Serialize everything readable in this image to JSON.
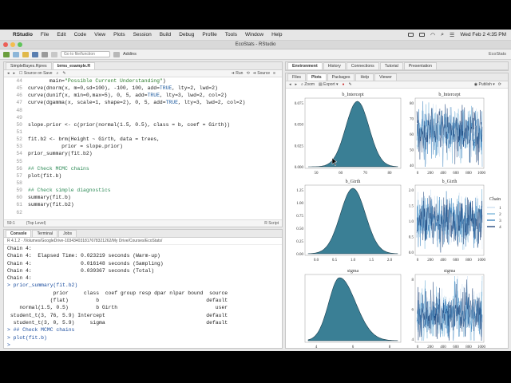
{
  "menubar": {
    "app": "RStudio",
    "items": [
      "File",
      "Edit",
      "Code",
      "View",
      "Plots",
      "Session",
      "Build",
      "Debug",
      "Profile",
      "Tools",
      "Window",
      "Help"
    ],
    "clock": "Wed Feb 2  4:35 PM"
  },
  "window": {
    "title": "EcoStats - RStudio"
  },
  "toolbar": {
    "goto_placeholder": "Go to file/function",
    "addins": "Addins",
    "project": "EcoStats"
  },
  "editor": {
    "tabs": [
      "SimpleBayes.Rpres",
      "brms_example.R"
    ],
    "source_on_save": "Source on Save",
    "run": "Run",
    "source": "Source",
    "lines": [
      {
        "n": "44",
        "t": "       main=\"Possible Current Understanding\")"
      },
      {
        "n": "45",
        "t": "curve(dnorm(x, m=0,sd=100), -100, 100, add=TRUE, lty=2, lwd=2)"
      },
      {
        "n": "46",
        "t": "curve(dunif(x, min=0,max=5), 0, 5, add=TRUE, lty=3, lwd=2, col=2)"
      },
      {
        "n": "47",
        "t": "curve(dgamma(x, scale=1, shape=2), 0, 5, add=TRUE, lty=3, lwd=2, col=2)"
      },
      {
        "n": "48",
        "t": ""
      },
      {
        "n": "49",
        "t": ""
      },
      {
        "n": "50",
        "t": "slope.prior <- c(prior(normal(1.5, 0.5), class = b, coef = Girth))"
      },
      {
        "n": "51",
        "t": ""
      },
      {
        "n": "52",
        "t": "fit.b2 <- brm(Height ~ Girth, data = trees,"
      },
      {
        "n": "53",
        "t": "           prior = slope.prior)"
      },
      {
        "n": "54",
        "t": "prior_summary(fit.b2)"
      },
      {
        "n": "55",
        "t": ""
      },
      {
        "n": "56",
        "t": "## Check MCMC chains"
      },
      {
        "n": "57",
        "t": "plot(fit.b)"
      },
      {
        "n": "58",
        "t": ""
      },
      {
        "n": "59",
        "t": "## Check simple diagnostics"
      },
      {
        "n": "60",
        "t": "summary(fit.b)"
      },
      {
        "n": "61",
        "t": "summary(fit.b2)"
      },
      {
        "n": "62",
        "t": ""
      }
    ],
    "status_pos": "59:1",
    "status_level": "(Top Level)",
    "status_type": "R Script"
  },
  "console": {
    "tabs": [
      "Console",
      "Terminal",
      "Jobs"
    ],
    "path": "R 4.1.2 · /Volumes/GoogleDrive-103434031817678321262/My Drive/Courses/EcoStats/",
    "lines": [
      "Chain 4:",
      "Chain 4:  Elapsed Time: 0.023219 seconds (Warm-up)",
      "Chain 4:                0.016148 seconds (Sampling)",
      "Chain 4:                0.039367 seconds (Total)",
      "Chain 4:",
      "> prior_summary(fit.b2)",
      "               prior     class  coef group resp dpar nlpar bound  source",
      "              (flat)         b                                   default",
      "    normal(1.5, 0.5)         b Girth                                user",
      " student_t(3, 76, 5.9) Intercept                                 default",
      "  student_t(3, 0, 5.9)     sigma                                 default",
      "> ## Check MCMC chains",
      "> plot(fit.b)",
      ">"
    ]
  },
  "env": {
    "tabs": [
      "Environment",
      "History",
      "Connections",
      "Tutorial",
      "Presentation"
    ]
  },
  "plots": {
    "tabs": [
      "Files",
      "Plots",
      "Packages",
      "Help",
      "Viewer"
    ],
    "zoom": "Zoom",
    "export": "Export",
    "publish": "Publish",
    "titles": [
      "b_Intercept",
      "b_Intercept",
      "b_Girth",
      "b_Girth",
      "sigma",
      "sigma"
    ],
    "legend_title": "Chain",
    "legend_items": [
      "1",
      "2",
      "3",
      "4"
    ],
    "dens_axes": [
      {
        "y": [
          "0.075",
          "0.050",
          "0.025",
          "0.000"
        ],
        "x": [
          "50",
          "60",
          "70",
          "80"
        ]
      },
      {
        "y": [
          "1.25",
          "1.00",
          "0.75",
          "0.50",
          "0.25",
          "0.00"
        ],
        "x": [
          "0.0",
          "0.5",
          "1.0",
          "1.5",
          "2.0"
        ]
      },
      {
        "y": [],
        "x": [
          "4",
          "6",
          "8"
        ]
      }
    ],
    "trace_axes": [
      {
        "y": [
          "80",
          "70",
          "60",
          "50",
          "40"
        ],
        "x": [
          "0",
          "200",
          "400",
          "600",
          "800",
          "1000"
        ]
      },
      {
        "y": [
          "2.0",
          "1.5",
          "1.0",
          "0.5",
          "0.0"
        ],
        "x": [
          "0",
          "200",
          "400",
          "600",
          "800",
          "1000"
        ]
      },
      {
        "y": [
          "8",
          "6",
          "4"
        ],
        "x": [
          "0",
          "200",
          "400",
          "600",
          "800",
          "1000"
        ]
      }
    ]
  }
}
